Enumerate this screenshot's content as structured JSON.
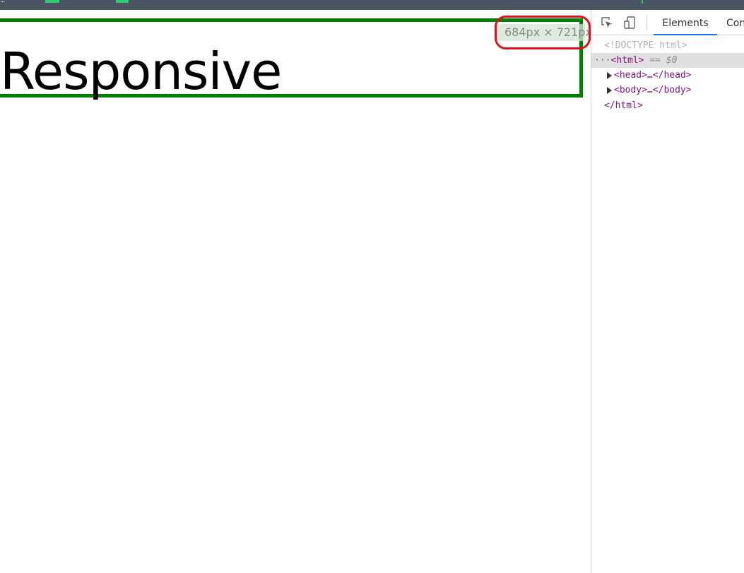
{
  "heading": "Responsive",
  "viewport_size": "684px × 721px",
  "devtools": {
    "tabs": [
      "Elements",
      "Con"
    ],
    "active_tab": "Elements",
    "dom": {
      "doctype": "<!DOCTYPE html>",
      "html_open": "<html>",
      "selected_marker": "== $0",
      "ellipsis": "···",
      "head_node": "<head>…</head>",
      "body_node": "<body>…</body>",
      "html_close": "</html>"
    }
  },
  "colors": {
    "box_border": "#008000",
    "highlight": "#e0101a",
    "active_tab_underline": "#1a73e8",
    "tag": "#881280"
  },
  "icons": [
    "inspect-element-icon",
    "device-toggle-icon"
  ]
}
